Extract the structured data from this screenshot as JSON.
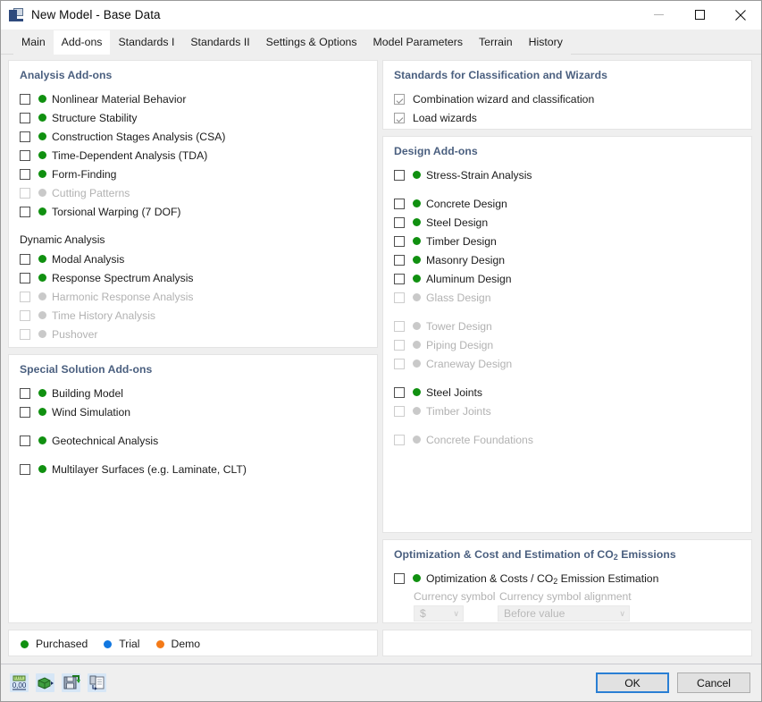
{
  "window": {
    "title": "New Model - Base Data",
    "icon": "app-base-data-icon",
    "minimize_label": "—",
    "maximize_label": "□",
    "close_label": "✕"
  },
  "tabs": [
    {
      "label": "Main",
      "selected": false
    },
    {
      "label": "Add-ons",
      "selected": true
    },
    {
      "label": "Standards I",
      "selected": false
    },
    {
      "label": "Standards II",
      "selected": false
    },
    {
      "label": "Settings & Options",
      "selected": false
    },
    {
      "label": "Model Parameters",
      "selected": false
    },
    {
      "label": "Terrain",
      "selected": false
    },
    {
      "label": "History",
      "selected": false
    }
  ],
  "colors": {
    "header": "#4a5f7f",
    "purchased": "#109010",
    "trial": "#1177e0",
    "demo": "#f47a17",
    "disabled": "#c9c9c9",
    "focus": "#2a7fd4"
  },
  "left": {
    "analysis": {
      "title": "Analysis Add-ons",
      "items": [
        {
          "label": "Nonlinear Material Behavior",
          "checked": false,
          "enabled": true,
          "status": "purchased"
        },
        {
          "label": "Structure Stability",
          "checked": false,
          "enabled": true,
          "status": "purchased"
        },
        {
          "label": "Construction Stages Analysis (CSA)",
          "checked": false,
          "enabled": true,
          "status": "purchased"
        },
        {
          "label": "Time-Dependent Analysis (TDA)",
          "checked": false,
          "enabled": true,
          "status": "purchased"
        },
        {
          "label": "Form-Finding",
          "checked": false,
          "enabled": true,
          "status": "purchased"
        },
        {
          "label": "Cutting Patterns",
          "checked": false,
          "enabled": false,
          "status": "disabled"
        },
        {
          "label": "Torsional Warping (7 DOF)",
          "checked": false,
          "enabled": true,
          "status": "purchased"
        }
      ],
      "subgroup_title": "Dynamic Analysis",
      "subgroup_items": [
        {
          "label": "Modal Analysis",
          "checked": false,
          "enabled": true,
          "status": "purchased"
        },
        {
          "label": "Response Spectrum Analysis",
          "checked": false,
          "enabled": true,
          "status": "purchased"
        },
        {
          "label": "Harmonic Response Analysis",
          "checked": false,
          "enabled": false,
          "status": "disabled"
        },
        {
          "label": "Time History Analysis",
          "checked": false,
          "enabled": false,
          "status": "disabled"
        },
        {
          "label": "Pushover",
          "checked": false,
          "enabled": false,
          "status": "disabled"
        }
      ]
    },
    "special": {
      "title": "Special Solution Add-ons",
      "items": [
        {
          "label": "Building Model",
          "checked": false,
          "enabled": true,
          "status": "purchased",
          "spacer": false
        },
        {
          "label": "Wind Simulation",
          "checked": false,
          "enabled": true,
          "status": "purchased",
          "spacer": false
        },
        {
          "label": "Geotechnical Analysis",
          "checked": false,
          "enabled": true,
          "status": "purchased",
          "spacer": true
        },
        {
          "label": "Multilayer Surfaces (e.g. Laminate, CLT)",
          "checked": false,
          "enabled": true,
          "status": "purchased",
          "spacer": true
        }
      ]
    },
    "legend": [
      {
        "label": "Purchased",
        "status": "purchased"
      },
      {
        "label": "Trial",
        "status": "trial"
      },
      {
        "label": "Demo",
        "status": "demo"
      }
    ]
  },
  "right": {
    "standards": {
      "title": "Standards for Classification and Wizards",
      "items": [
        {
          "label": "Combination wizard and classification",
          "checked": true,
          "enabled": true,
          "status": "none"
        },
        {
          "label": "Load wizards",
          "checked": true,
          "enabled": true,
          "status": "none"
        }
      ]
    },
    "design": {
      "title": "Design Add-ons",
      "items": [
        {
          "label": "Stress-Strain Analysis",
          "checked": false,
          "enabled": true,
          "status": "purchased",
          "spacer": false
        },
        {
          "label": "Concrete Design",
          "checked": false,
          "enabled": true,
          "status": "purchased",
          "spacer": true
        },
        {
          "label": "Steel Design",
          "checked": false,
          "enabled": true,
          "status": "purchased",
          "spacer": false
        },
        {
          "label": "Timber Design",
          "checked": false,
          "enabled": true,
          "status": "purchased",
          "spacer": false
        },
        {
          "label": "Masonry Design",
          "checked": false,
          "enabled": true,
          "status": "purchased",
          "spacer": false
        },
        {
          "label": "Aluminum Design",
          "checked": false,
          "enabled": true,
          "status": "purchased",
          "spacer": false
        },
        {
          "label": "Glass Design",
          "checked": false,
          "enabled": false,
          "status": "disabled",
          "spacer": false
        },
        {
          "label": "Tower Design",
          "checked": false,
          "enabled": false,
          "status": "disabled",
          "spacer": true
        },
        {
          "label": "Piping Design",
          "checked": false,
          "enabled": false,
          "status": "disabled",
          "spacer": false
        },
        {
          "label": "Craneway Design",
          "checked": false,
          "enabled": false,
          "status": "disabled",
          "spacer": false
        },
        {
          "label": "Steel Joints",
          "checked": false,
          "enabled": true,
          "status": "purchased",
          "spacer": true
        },
        {
          "label": "Timber Joints",
          "checked": false,
          "enabled": false,
          "status": "disabled",
          "spacer": false
        },
        {
          "label": "Concrete Foundations",
          "checked": false,
          "enabled": false,
          "status": "disabled",
          "spacer": true
        }
      ]
    },
    "optimization": {
      "title_before": "Optimization & Cost and Estimation of CO",
      "title_sub": "2",
      "title_after": " Emissions",
      "item_before": "Optimization & Costs / CO",
      "item_sub": "2",
      "item_after": " Emission Estimation",
      "item_checked": false,
      "currency_symbol_label": "Currency symbol",
      "currency_symbol_value": "$",
      "currency_alignment_label": "Currency symbol alignment",
      "currency_alignment_value": "Before value",
      "chevron": "∨"
    }
  },
  "footer": {
    "tools": [
      {
        "name": "number-format-icon",
        "caption": "0,00"
      },
      {
        "name": "units-export-icon",
        "caption": ""
      },
      {
        "name": "save-defaults-icon",
        "caption": ""
      },
      {
        "name": "copy-from-icon",
        "caption": ""
      }
    ],
    "ok_label": "OK",
    "cancel_label": "Cancel"
  }
}
